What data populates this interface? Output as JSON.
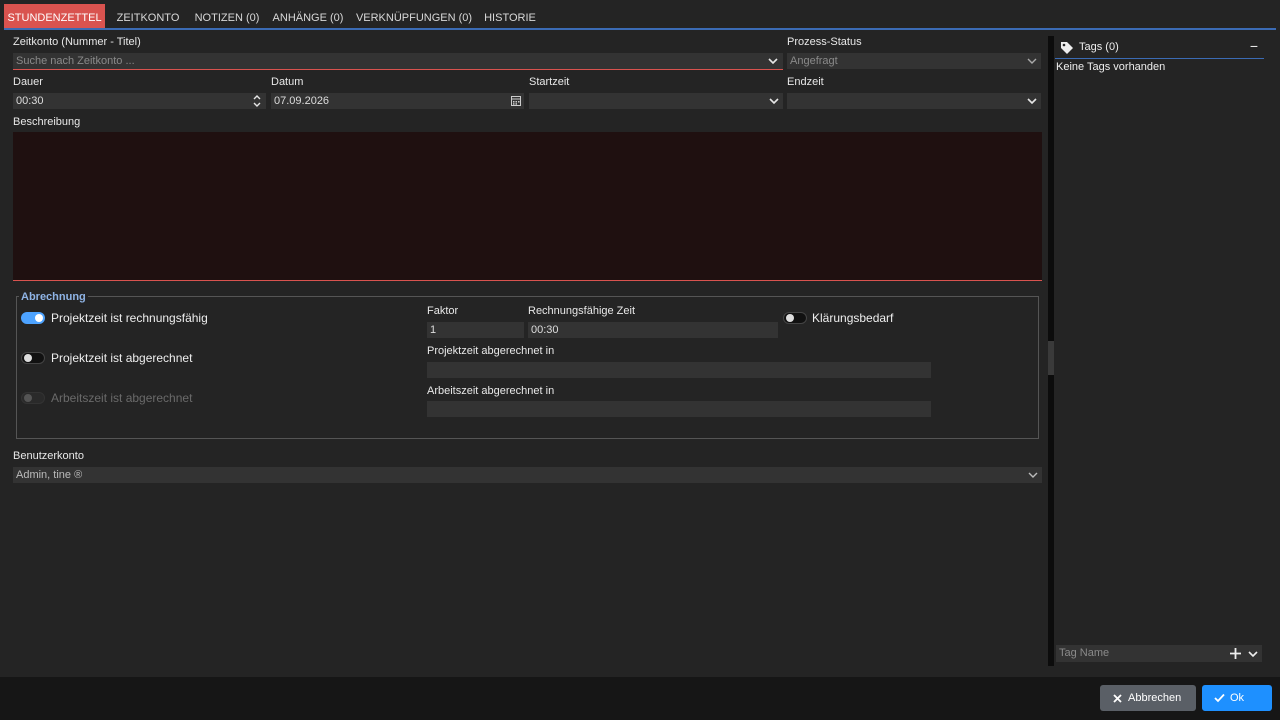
{
  "tabs": [
    {
      "label": "STUNDENZETTEL",
      "active": true
    },
    {
      "label": "ZEITKONTO"
    },
    {
      "label": "NOTIZEN (0)"
    },
    {
      "label": "ANHÄNGE (0)"
    },
    {
      "label": "VERKNÜPFUNGEN (0)"
    },
    {
      "label": "HISTORIE"
    }
  ],
  "form": {
    "zeitkonto_label": "Zeitkonto (Nummer - Titel)",
    "zeitkonto_placeholder": "Suche nach Zeitkonto ...",
    "status_label": "Prozess-Status",
    "status_value": "Angefragt",
    "dauer_label": "Dauer",
    "dauer_value": "00:30",
    "datum_label": "Datum",
    "datum_value": "07.09.2026",
    "startzeit_label": "Startzeit",
    "endzeit_label": "Endzeit",
    "beschreibung_label": "Beschreibung"
  },
  "abrechnung": {
    "title": "Abrechnung",
    "rechnungsfaehig_label": "Projektzeit ist rechnungsfähig",
    "rechnungsfaehig_on": true,
    "abgerechnet_label": "Projektzeit ist abgerechnet",
    "arbeitszeit_label": "Arbeitszeit ist abgerechnet",
    "faktor_label": "Faktor",
    "faktor_value": "1",
    "rz_label": "Rechnungsfähige Zeit",
    "rz_value": "00:30",
    "klaerung_label": "Klärungsbedarf",
    "projekt_in_label": "Projektzeit abgerechnet in",
    "arbeit_in_label": "Arbeitszeit abgerechnet in"
  },
  "benutzer": {
    "label": "Benutzerkonto",
    "value": "Admin, tine ®"
  },
  "tags": {
    "title": "Tags (0)",
    "empty": "Keine Tags vorhanden",
    "input_placeholder": "Tag Name"
  },
  "buttons": {
    "cancel": "Abbrechen",
    "ok": "Ok"
  },
  "colors": {
    "accent": "#3b6bb4",
    "active_tab": "#d9534f",
    "ok_button": "#1e90ff",
    "toggle_on": "#4da3ff"
  }
}
